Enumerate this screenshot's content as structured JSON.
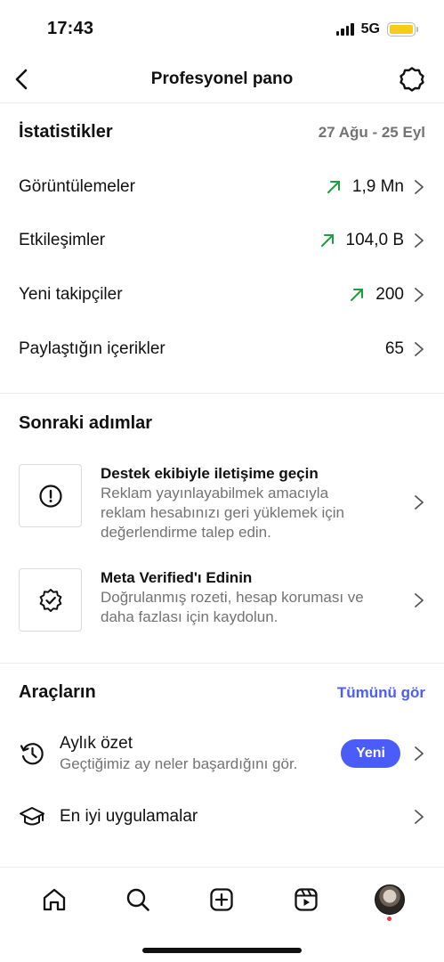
{
  "status_bar": {
    "time": "17:43",
    "network": "5G"
  },
  "header": {
    "title": "Profesyonel pano"
  },
  "stats": {
    "title": "İstatistikler",
    "date_range": "27 Ağu - 25 Eyl",
    "rows": [
      {
        "label": "Görüntülemeler",
        "value": "1,9 Mn",
        "trend": "up"
      },
      {
        "label": "Etkileşimler",
        "value": "104,0 B",
        "trend": "up"
      },
      {
        "label": "Yeni takipçiler",
        "value": "200",
        "trend": "up"
      },
      {
        "label": "Paylaştığın içerikler",
        "value": "65",
        "trend": "none"
      }
    ]
  },
  "next_steps": {
    "title": "Sonraki adımlar",
    "items": [
      {
        "title": "Destek ekibiyle iletişime geçin",
        "desc": "Reklam yayınlayabilmek amacıyla reklam hesabınızı geri yüklemek için değerlendirme talep edin.",
        "icon": "alert-circle-icon"
      },
      {
        "title": "Meta Verified'ı Edinin",
        "desc": "Doğrulanmış rozeti, hesap koruması ve daha fazlası için kaydolun.",
        "icon": "verified-badge-icon"
      }
    ]
  },
  "tools": {
    "title": "Araçların",
    "see_all": "Tümünü gör",
    "items": [
      {
        "title": "Aylık özet",
        "desc": "Geçtiğimiz ay neler başardığını gör.",
        "badge": "Yeni",
        "icon": "history-icon"
      },
      {
        "title": "En iyi uygulamalar",
        "icon": "graduation-cap-icon"
      }
    ]
  },
  "colors": {
    "accent": "#4a5df9",
    "trend_up": "#1a9e3e",
    "muted": "#737373",
    "notification": "#ff3040"
  },
  "tab_bar": [
    "home-icon",
    "search-icon",
    "create-icon",
    "reels-icon",
    "profile-avatar"
  ]
}
